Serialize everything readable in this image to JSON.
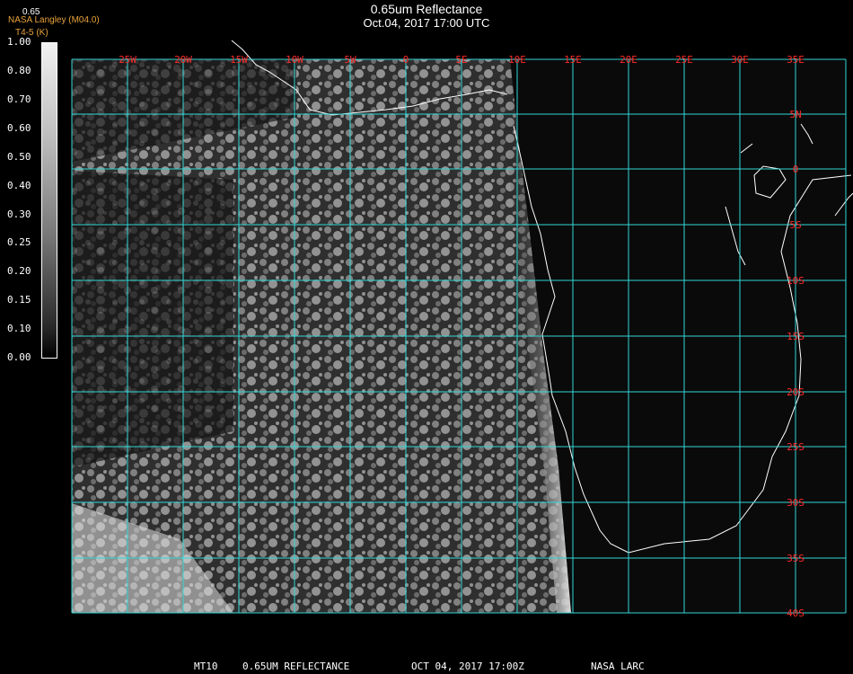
{
  "title": "0.65um Reflectance",
  "subtitle": "Oct.04, 2017 17:00 UTC",
  "credit": "NASA Langley (M04.0)",
  "credit_sub": "T4-5 (K)",
  "colorbar_label": "0.65",
  "colorbar_ticks": [
    "1.00",
    "0.80",
    "0.70",
    "0.60",
    "0.50",
    "0.40",
    "0.30",
    "0.25",
    "0.20",
    "0.15",
    "0.10",
    "0.00"
  ],
  "lon_labels": [
    "25W",
    "20W",
    "15W",
    "10W",
    "5W",
    "0",
    "5E",
    "10E",
    "15E",
    "20E",
    "25E",
    "30E",
    "35E"
  ],
  "lat_labels": [
    "5N",
    "0",
    "5S",
    "10S",
    "15S",
    "20S",
    "25S",
    "30S",
    "35S",
    "40S"
  ],
  "footer": {
    "product": "MT10",
    "name": "0.65UM REFLECTANCE",
    "time": "OCT 04, 2017 17:00Z",
    "source": "NASA LARC"
  },
  "colors": {
    "grid": "#33d6d6",
    "labels": "#ff2a2a",
    "coast": "#ffffff",
    "credit": "#e8a23a"
  },
  "icons": {
    "colorbar": "grayscale-colorbar"
  }
}
